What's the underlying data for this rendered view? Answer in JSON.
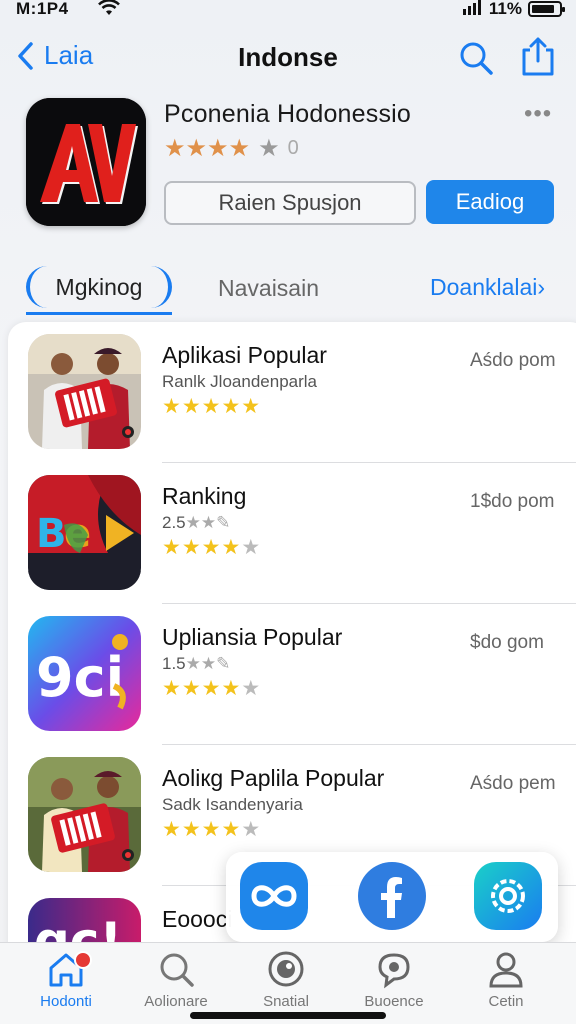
{
  "status_bar": {
    "time": "M:1P4",
    "battery_text": "11%",
    "battery_level": 0.85
  },
  "nav": {
    "back_label": "Laia",
    "title": "Indonse"
  },
  "app": {
    "name": "Pconenia Hodonessio",
    "rating_count": "0",
    "secondary_button": "Raien Spusjon",
    "primary_button": "Eadiog",
    "icon_text": "AV"
  },
  "tabs": [
    {
      "label": "Mgkinog",
      "active": true
    },
    {
      "label": "Navaisain",
      "active": false
    },
    {
      "label": "Doanklalai›",
      "active": false
    }
  ],
  "list": [
    {
      "title": "Aplikasi Popular",
      "subtitle": "Ranlk Jloandenparla",
      "price": "Aśdo pom",
      "stars_full": 5,
      "stars_text": "★★★★★",
      "rating_text": ""
    },
    {
      "title": "Ranking",
      "subtitle": "",
      "price": "1$do pom",
      "stars_full": 4,
      "stars_text": "★★★★",
      "stars_dim": "★",
      "rating_text": "2.5"
    },
    {
      "title": "Upliansia Popular",
      "subtitle": "",
      "price": "$do gom",
      "stars_full": 4,
      "stars_text": "★★★★",
      "stars_dim": "★",
      "rating_text": "1.5"
    },
    {
      "title": "Aoliкg Paplila Popular",
      "subtitle": "Sadk Isandenyaria",
      "price": "Aśdo pem",
      "stars_full": 4,
      "stars_text": "★★★★",
      "stars_dim": "★",
      "rating_text": ""
    },
    {
      "title": "Eoooci",
      "subtitle": "",
      "price": "",
      "stars_full": 0,
      "stars_text": "",
      "rating_text": ""
    }
  ],
  "share_popup": {
    "items": [
      {
        "icon": "infinity-icon",
        "color": "#1f86ea"
      },
      {
        "icon": "facebook-icon",
        "color": "#2f7de0"
      },
      {
        "icon": "gear-icon",
        "color": "#1ca0e8"
      }
    ]
  },
  "tab_bar": [
    {
      "label": "Hodonti",
      "icon": "home-icon",
      "active": true
    },
    {
      "label": "Aolionare",
      "icon": "search-icon",
      "active": false
    },
    {
      "label": "Snatial",
      "icon": "gamepad-icon",
      "active": false
    },
    {
      "label": "Buoence",
      "icon": "chat-icon",
      "active": false
    },
    {
      "label": "Cetin",
      "icon": "person-icon",
      "active": false
    }
  ],
  "colors": {
    "accent": "#1a7cf0",
    "star": "#f3c21c",
    "rating_star": "#e0914a"
  }
}
